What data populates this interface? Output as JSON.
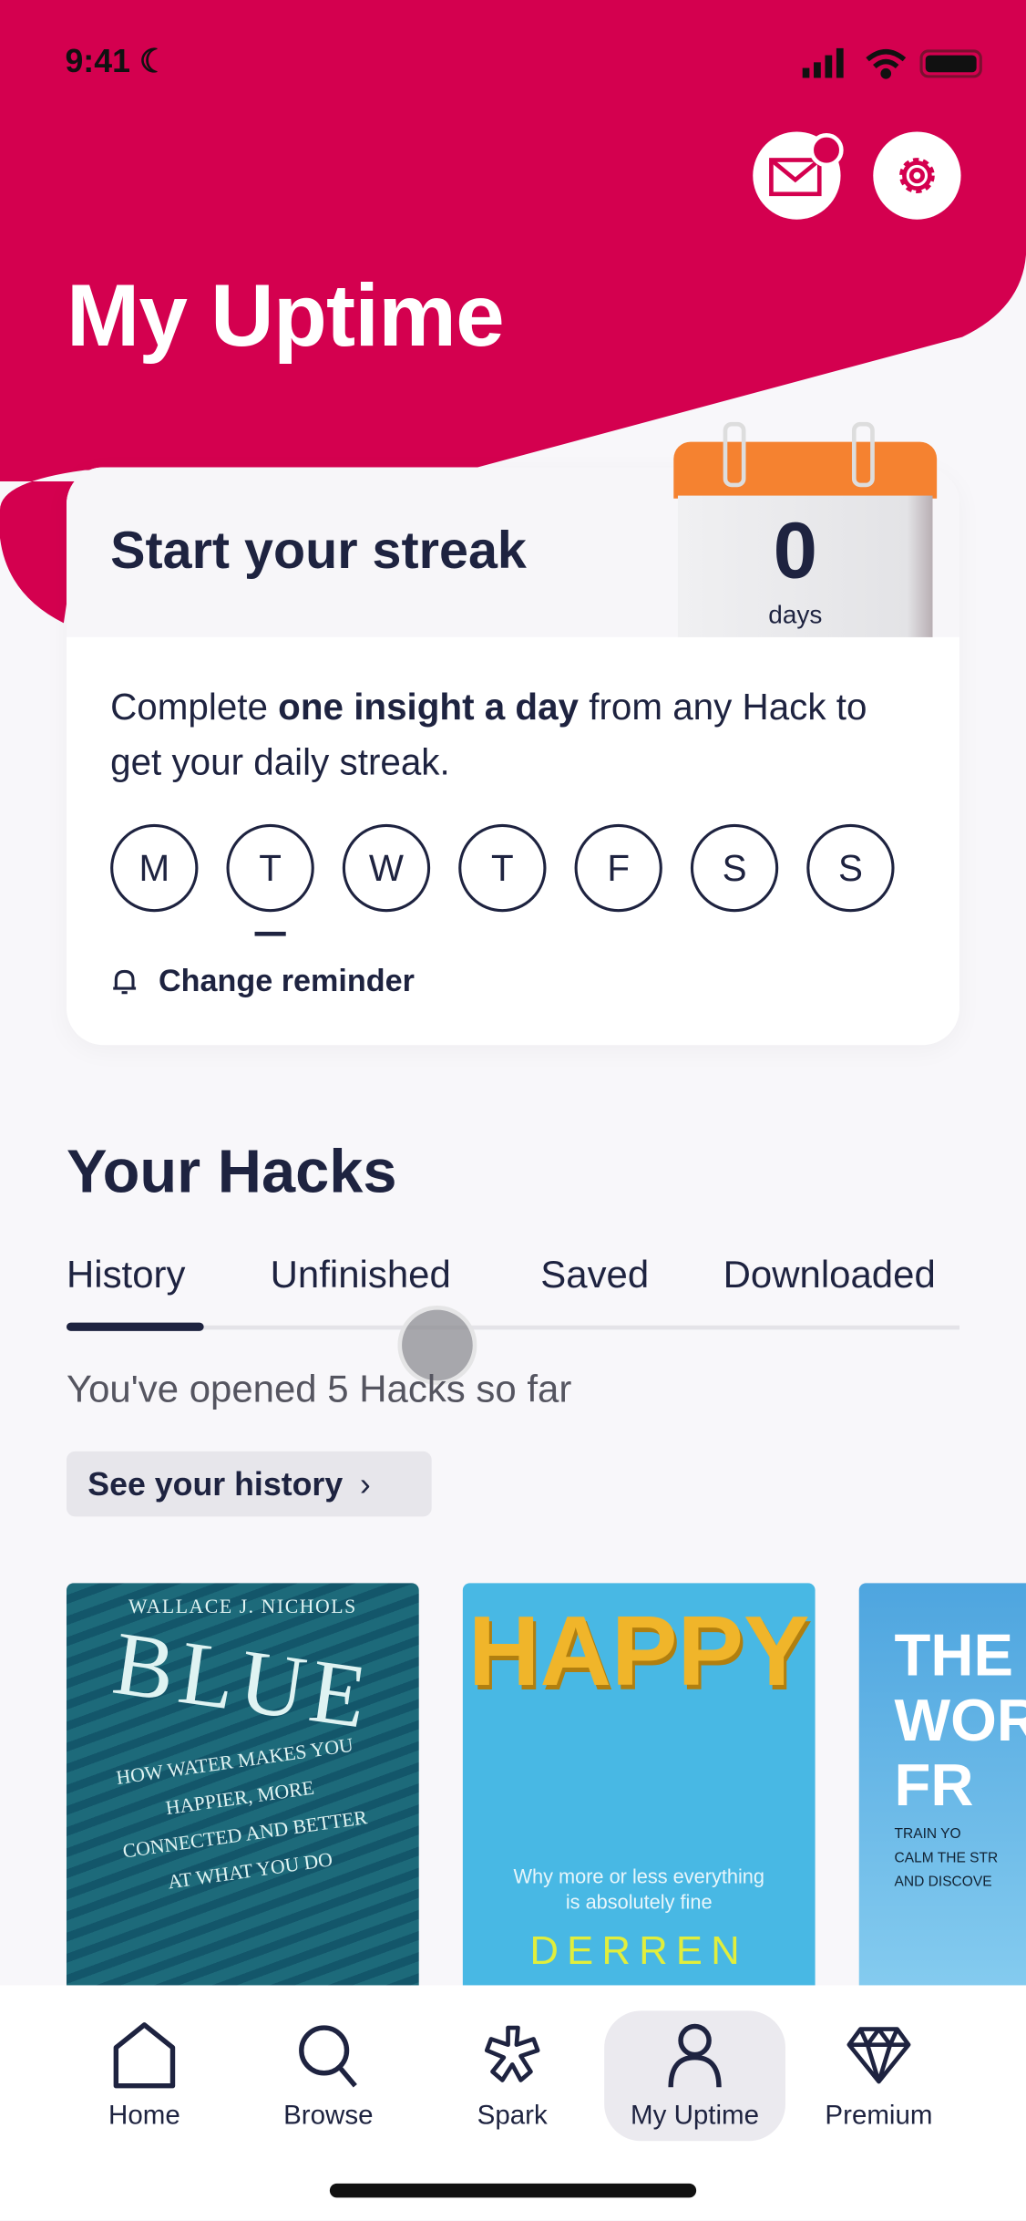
{
  "status_bar": {
    "time": "9:41"
  },
  "header": {
    "title": "My Uptime",
    "accent": "#d4004f"
  },
  "streak": {
    "title": "Start your streak",
    "count": "0",
    "unit": "days",
    "desc_pre": "Complete ",
    "desc_bold": "one insight a day",
    "desc_post": " from any Hack to get your daily streak.",
    "days": [
      "M",
      "T",
      "W",
      "T",
      "F",
      "S",
      "S"
    ],
    "current_day_index": 1,
    "reminder_label": "Change reminder"
  },
  "hacks": {
    "title": "Your Hacks",
    "tabs": [
      {
        "label": "History",
        "active": true
      },
      {
        "label": "Unfinished"
      },
      {
        "label": "Saved"
      },
      {
        "label": "Downloaded"
      }
    ],
    "opened_text": "You've opened 5 Hacks so far",
    "history_button": "See your history",
    "books": [
      {
        "author": "WALLACE J. NICHOLS",
        "title": "BLUE",
        "subtitle": "HOW WATER MAKES YOU HAPPIER, MORE CONNECTED AND BETTER AT WHAT YOU DO"
      },
      {
        "title": "HAPPY",
        "subtitle": "Why more or less everything is absolutely fine",
        "author": "DERREN"
      },
      {
        "title": "THE WOR FR",
        "subtitle": "TRAIN YO",
        "tagline": "CALM THE STR",
        "tagline2": "AND DISCOVE"
      }
    ]
  },
  "nav": {
    "items": [
      {
        "label": "Home",
        "icon": "home-icon"
      },
      {
        "label": "Browse",
        "icon": "search-icon"
      },
      {
        "label": "Spark",
        "icon": "spark-icon"
      },
      {
        "label": "My Uptime",
        "icon": "person-icon",
        "active": true
      },
      {
        "label": "Premium",
        "icon": "diamond-icon"
      }
    ]
  }
}
